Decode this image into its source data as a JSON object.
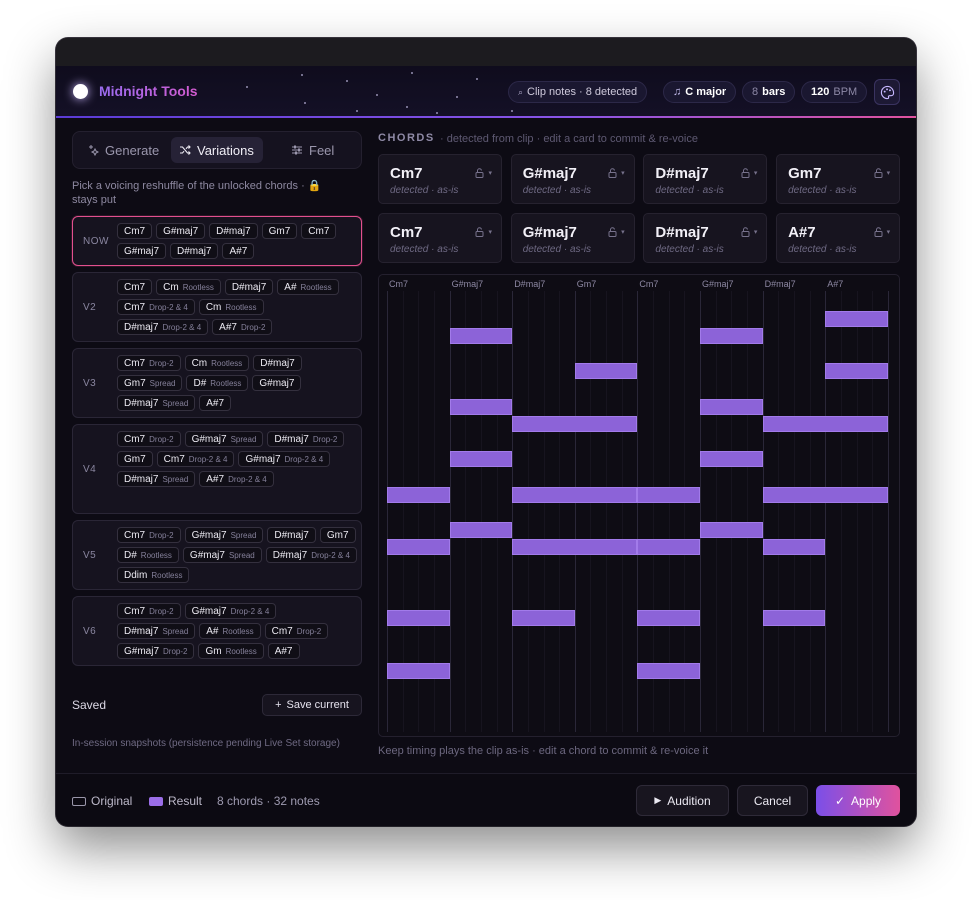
{
  "app": {
    "title": "Midnight Tools"
  },
  "header": {
    "clip_notes": "Clip notes · 8 detected",
    "key": "C major",
    "bars_value": "8",
    "bars_unit": "bars",
    "bpm_value": "120",
    "bpm_unit": "BPM"
  },
  "tabs": [
    {
      "label": "Generate",
      "icon": "sparkle-icon"
    },
    {
      "label": "Variations",
      "icon": "shuffle-icon"
    },
    {
      "label": "Feel",
      "icon": "sliders-icon"
    }
  ],
  "hint": "Pick a voicing reshuffle of the unlocked chords ·",
  "hint_end": "stays put",
  "variations": [
    {
      "label": "NOW",
      "chips": [
        [
          "Cm7",
          ""
        ],
        [
          "G#maj7",
          ""
        ],
        [
          "D#maj7",
          ""
        ],
        [
          "Gm7",
          ""
        ],
        [
          "Cm7",
          ""
        ],
        [
          "G#maj7",
          ""
        ],
        [
          "D#maj7",
          ""
        ],
        [
          "A#7",
          ""
        ]
      ]
    },
    {
      "label": "V2",
      "chips": [
        [
          "Cm7",
          ""
        ],
        [
          "Cm",
          "Rootless"
        ],
        [
          "D#maj7",
          ""
        ],
        [
          "A#",
          "Rootless"
        ],
        [
          "Cm7",
          "Drop-2 & 4"
        ],
        [
          "Cm",
          "Rootless"
        ],
        [
          "D#maj7",
          "Drop-2 & 4"
        ],
        [
          "A#7",
          "Drop-2"
        ]
      ]
    },
    {
      "label": "V3",
      "chips": [
        [
          "Cm7",
          "Drop-2"
        ],
        [
          "Cm",
          "Rootless"
        ],
        [
          "D#maj7",
          ""
        ],
        [
          "Gm7",
          "Spread"
        ],
        [
          "D#",
          "Rootless"
        ],
        [
          "G#maj7",
          ""
        ],
        [
          "D#maj7",
          "Spread"
        ],
        [
          "A#7",
          ""
        ]
      ]
    },
    {
      "label": "V4",
      "chips": [
        [
          "Cm7",
          "Drop-2"
        ],
        [
          "G#maj7",
          "Spread"
        ],
        [
          "D#maj7",
          "Drop-2"
        ],
        [
          "Gm7",
          ""
        ],
        [
          "Cm7",
          "Drop-2 & 4"
        ],
        [
          "G#maj7",
          "Drop-2 & 4"
        ],
        [
          "D#maj7",
          "Spread"
        ],
        [
          "A#7",
          "Drop-2 & 4"
        ]
      ]
    },
    {
      "label": "V5",
      "chips": [
        [
          "Cm7",
          "Drop-2"
        ],
        [
          "G#maj7",
          "Spread"
        ],
        [
          "D#maj7",
          ""
        ],
        [
          "Gm7",
          ""
        ],
        [
          "D#",
          "Rootless"
        ],
        [
          "G#maj7",
          "Spread"
        ],
        [
          "D#maj7",
          "Drop-2 & 4"
        ],
        [
          "Ddim",
          "Rootless"
        ]
      ]
    },
    {
      "label": "V6",
      "chips": [
        [
          "Cm7",
          "Drop-2"
        ],
        [
          "G#maj7",
          "Drop-2 & 4"
        ],
        [
          "D#maj7",
          "Spread"
        ],
        [
          "A#",
          "Rootless"
        ],
        [
          "Cm7",
          "Drop-2"
        ],
        [
          "G#maj7",
          "Drop-2"
        ],
        [
          "Gm",
          "Rootless"
        ],
        [
          "A#7",
          ""
        ]
      ]
    }
  ],
  "saved": {
    "label": "Saved",
    "button": "Save current",
    "hint": "In-session snapshots (persistence pending Live Set storage)"
  },
  "chords_panel": {
    "title": "CHORDS",
    "subtitle": "· detected from clip · edit a card to commit & re-voice",
    "cards": [
      {
        "name": "Cm7",
        "status": "detected · as-is"
      },
      {
        "name": "G#maj7",
        "status": "detected · as-is"
      },
      {
        "name": "D#maj7",
        "status": "detected · as-is"
      },
      {
        "name": "Gm7",
        "status": "detected · as-is"
      },
      {
        "name": "Cm7",
        "status": "detected · as-is"
      },
      {
        "name": "G#maj7",
        "status": "detected · as-is"
      },
      {
        "name": "D#maj7",
        "status": "detected · as-is"
      },
      {
        "name": "A#7",
        "status": "detected · as-is"
      }
    ]
  },
  "piano_roll": {
    "labels": [
      "Cm7",
      "G#maj7",
      "D#maj7",
      "Gm7",
      "Cm7",
      "G#maj7",
      "D#maj7",
      "A#7"
    ],
    "beats": 16,
    "rows": 24,
    "notes": [
      {
        "row": 15,
        "start": 0,
        "len": 2
      },
      {
        "row": 18,
        "start": 0,
        "len": 2
      },
      {
        "row": 22,
        "start": 0,
        "len": 2
      },
      {
        "row": 25,
        "start": 0,
        "len": 2
      },
      {
        "row": 6,
        "start": 2,
        "len": 2
      },
      {
        "row": 10,
        "start": 2,
        "len": 2
      },
      {
        "row": 13,
        "start": 2,
        "len": 2
      },
      {
        "row": 17,
        "start": 2,
        "len": 2
      },
      {
        "row": 11,
        "start": 4,
        "len": 4
      },
      {
        "row": 15,
        "start": 4,
        "len": 4
      },
      {
        "row": 18,
        "start": 4,
        "len": 4
      },
      {
        "row": 22,
        "start": 4,
        "len": 2
      },
      {
        "row": 8,
        "start": 6,
        "len": 2
      },
      {
        "row": 15,
        "start": 8,
        "len": 2
      },
      {
        "row": 18,
        "start": 8,
        "len": 2
      },
      {
        "row": 22,
        "start": 8,
        "len": 2
      },
      {
        "row": 25,
        "start": 8,
        "len": 2
      },
      {
        "row": 6,
        "start": 10,
        "len": 2
      },
      {
        "row": 10,
        "start": 10,
        "len": 2
      },
      {
        "row": 13,
        "start": 10,
        "len": 2
      },
      {
        "row": 17,
        "start": 10,
        "len": 2
      },
      {
        "row": 11,
        "start": 12,
        "len": 4
      },
      {
        "row": 15,
        "start": 12,
        "len": 4
      },
      {
        "row": 18,
        "start": 12,
        "len": 2
      },
      {
        "row": 22,
        "start": 12,
        "len": 2
      },
      {
        "row": 5,
        "start": 14,
        "len": 2
      },
      {
        "row": 8,
        "start": 14,
        "len": 2
      }
    ],
    "hint": "Keep timing plays the clip as-is · edit a chord to commit & re-voice it"
  },
  "footer": {
    "legend_original": "Original",
    "legend_result": "Result",
    "count": "8 chords · 32 notes",
    "audition": "Audition",
    "cancel": "Cancel",
    "apply": "Apply"
  },
  "colors": {
    "accent": "#8c63d8",
    "brand_pink": "#e0529e",
    "background": "#0d0b14"
  }
}
